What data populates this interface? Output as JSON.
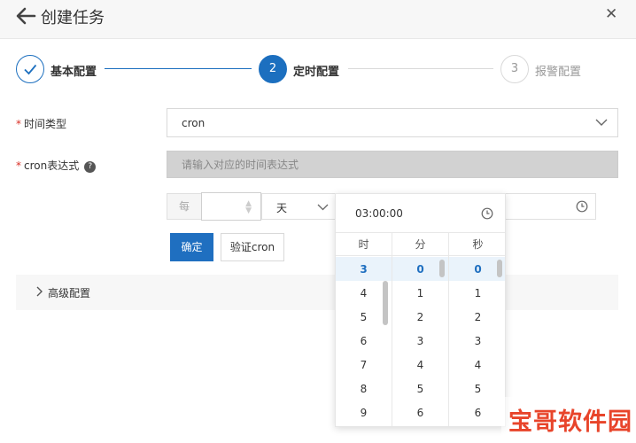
{
  "header": {
    "title": "创建任务",
    "back_icon": "arrow-left-icon",
    "close_icon": "close-icon"
  },
  "steps": [
    {
      "num": "✓",
      "label": "基本配置",
      "state": "done"
    },
    {
      "num": "2",
      "label": "定时配置",
      "state": "active"
    },
    {
      "num": "3",
      "label": "报警配置",
      "state": "pending"
    }
  ],
  "form": {
    "time_type": {
      "label": "时间类型",
      "required": "*",
      "value": "cron"
    },
    "cron_expr": {
      "label": "cron表达式",
      "required": "*",
      "help": "?",
      "placeholder": "请输入对应的时间表达式"
    },
    "every": {
      "prefix": "每",
      "unit": "天"
    }
  },
  "buttons": {
    "confirm": "确定",
    "verify": "验证cron"
  },
  "advanced": {
    "label": "高级配置"
  },
  "time_picker": {
    "value": "03:00:00",
    "columns": [
      {
        "header": "时",
        "items": [
          "3",
          "4",
          "5",
          "6",
          "7",
          "8",
          "9"
        ],
        "selected": "3"
      },
      {
        "header": "分",
        "items": [
          "0",
          "1",
          "2",
          "3",
          "4",
          "5",
          "6"
        ],
        "selected": "0"
      },
      {
        "header": "秒",
        "items": [
          "0",
          "1",
          "2",
          "3",
          "4",
          "5",
          "6"
        ],
        "selected": "0"
      }
    ]
  },
  "watermark": "宝哥软件园",
  "colors": {
    "primary": "#1f6fc0",
    "required": "#d93026",
    "watermark": "#e8442a"
  }
}
